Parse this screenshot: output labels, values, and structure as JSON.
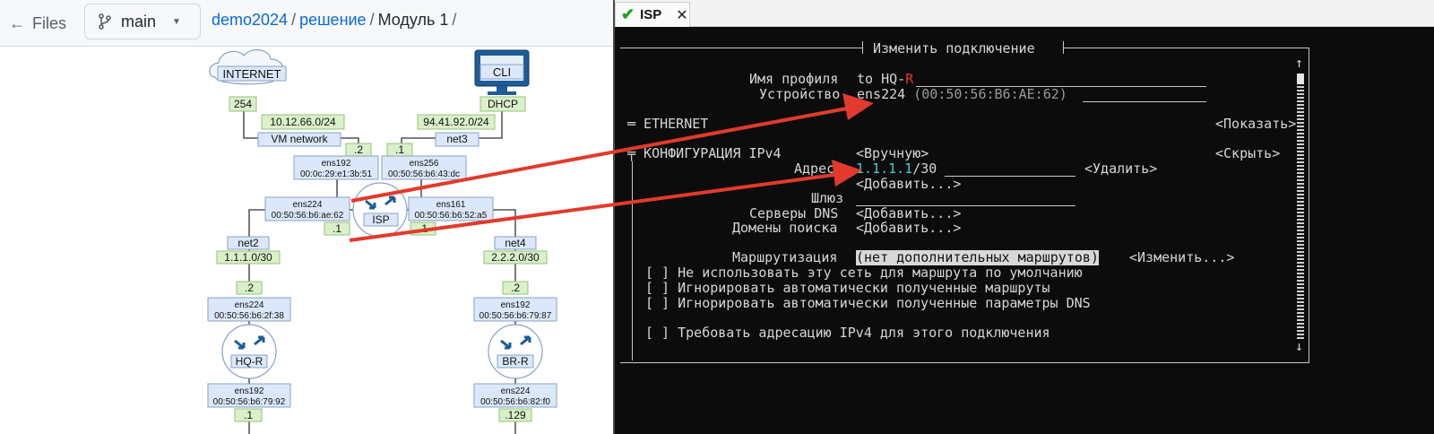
{
  "github": {
    "back_label": "Files",
    "branch": "main",
    "breadcrumb": {
      "repo": "demo2024",
      "folder": "решение",
      "current": "Модуль 1",
      "sep": "/"
    }
  },
  "diagram": {
    "internet": "INTERNET",
    "internet_ip": "254",
    "vm_net_subnet": "10.12.66.0/24",
    "vm_network": "VM network",
    "vm_net_ip": ".2",
    "cli": "CLI",
    "dhcp": "DHCP",
    "net3_subnet": "94.41.92.0/24",
    "net3": "net3",
    "net3_ip": ".1",
    "isp_ens192_name": "ens192",
    "isp_ens192_mac": "00:0c:29:e1:3b:51",
    "isp_ens256_name": "ens256",
    "isp_ens256_mac": "00:50:56:b6:43:dc",
    "isp_ens224_name": "ens224",
    "isp_ens224_mac": "00:50:56:b6:ae:62",
    "isp_ens161_name": "ens161",
    "isp_ens161_mac": "00:50:56:b6:52:a5",
    "isp": "ISP",
    "isp_left_ip": ".1",
    "isp_right_ip": ".1",
    "net2": "net2",
    "net2_subnet": "1.1.1.0/30",
    "net4": "net4",
    "net4_subnet": "2.2.2.0/30",
    "hq_ip": ".2",
    "br_ip": ".2",
    "hq_ens224_name": "ens224",
    "hq_ens224_mac": "00:50:56:b6:2f:38",
    "br_ens192_name": "ens192",
    "br_ens192_mac": "00:50:56:b6:79:87",
    "hq_router": "HQ-R",
    "br_router": "BR-R",
    "hq_ens192_name": "ens192",
    "hq_ens192_mac": "00:50:56:b6:79:92",
    "br_ens224_name": "ens224",
    "br_ens224_mac": "00:50:56:b6:82:f0",
    "hq_bottom_ip": ".1",
    "br_bottom_ip": ".129"
  },
  "terminal": {
    "tab_title": "ISP",
    "dialog_title": "Изменить подключение",
    "profile_label": "Имя профиля",
    "profile_value_prefix": "to HQ-",
    "profile_value_cursor": "R",
    "device_label": "Устройство",
    "device_value": "ens224",
    "device_mac": "(00:50:56:B6:AE:62)",
    "ethernet_label": "═ ETHERNET",
    "show_button": "<Показать>",
    "ipv4_label": "╤ КОНФИГУРАЦИЯ IPv4",
    "ipv4_mode": "<Вручную>",
    "hide_button": "<Скрыть>",
    "address_label": "Адреса",
    "address_value": "1.1.1.1",
    "address_prefix": "/30",
    "delete_button": "<Удалить>",
    "add_button": "<Добавить...>",
    "gateway_label": "Шлюз",
    "dns_label": "Серверы DNS",
    "search_label": "Домены поиска",
    "routing_label": "Маршрутизация",
    "routing_value": "(нет дополнительных маршрутов)",
    "routing_edit": "<Изменить...>",
    "checkboxes": [
      "[ ] Не использовать эту сеть для маршрута по умолчанию",
      "[ ] Игнорировать автоматически полученные маршруты",
      "[ ] Игнорировать автоматически полученные параметры DNS",
      "[ ] Требовать адресацию IPv4 для этого подключения"
    ],
    "scroll_up": "↑",
    "scroll_down": "↓"
  },
  "colors": {
    "arrow": "#e23a2c",
    "link": "#0969da",
    "node_fill": "#dbe8fb",
    "ip_fill": "#d9f0c9",
    "cyan": "#3fd0d8"
  }
}
